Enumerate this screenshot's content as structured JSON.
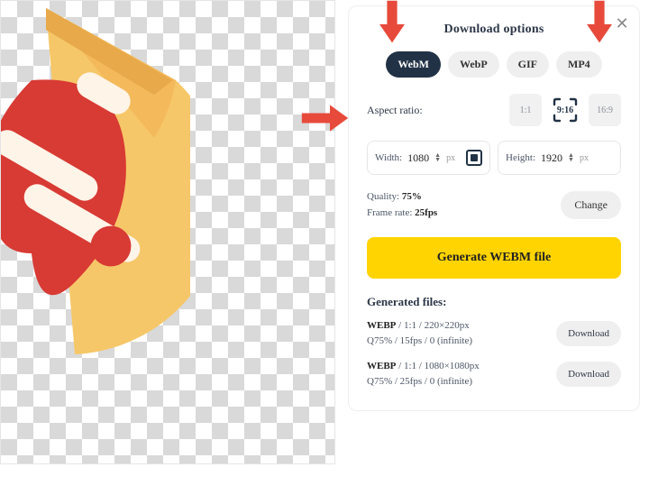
{
  "header": {
    "title": "Download options",
    "close_icon": "✕"
  },
  "formats": [
    {
      "id": "webm",
      "label": "WebM",
      "active": true
    },
    {
      "id": "webp",
      "label": "WebP",
      "active": false
    },
    {
      "id": "gif",
      "label": "GIF",
      "active": false
    },
    {
      "id": "mp4",
      "label": "MP4",
      "active": false
    }
  ],
  "aspect_ratio": {
    "label": "Aspect ratio:",
    "options": [
      "1:1",
      "9:16",
      "16:9"
    ],
    "selected": "9:16"
  },
  "dimensions": {
    "width_label": "Width:",
    "width_value": "1080",
    "height_label": "Height:",
    "height_value": "1920",
    "unit": "px",
    "linked": true
  },
  "quality": {
    "label": "Quality:",
    "value": "75%"
  },
  "frame_rate": {
    "label": "Frame rate:",
    "value": "25fps"
  },
  "change_label": "Change",
  "generate_label": "Generate WEBM file",
  "generated_header": "Generated files:",
  "files": [
    {
      "format": "WEBP",
      "ratio": "1:1",
      "size": "220×220px",
      "quality": "Q75%",
      "fps": "15fps",
      "loop": "0 (infinite)"
    },
    {
      "format": "WEBP",
      "ratio": "1:1",
      "size": "1080×1080px",
      "quality": "Q75%",
      "fps": "25fps",
      "loop": "0 (infinite)"
    }
  ],
  "download_label": "Download"
}
